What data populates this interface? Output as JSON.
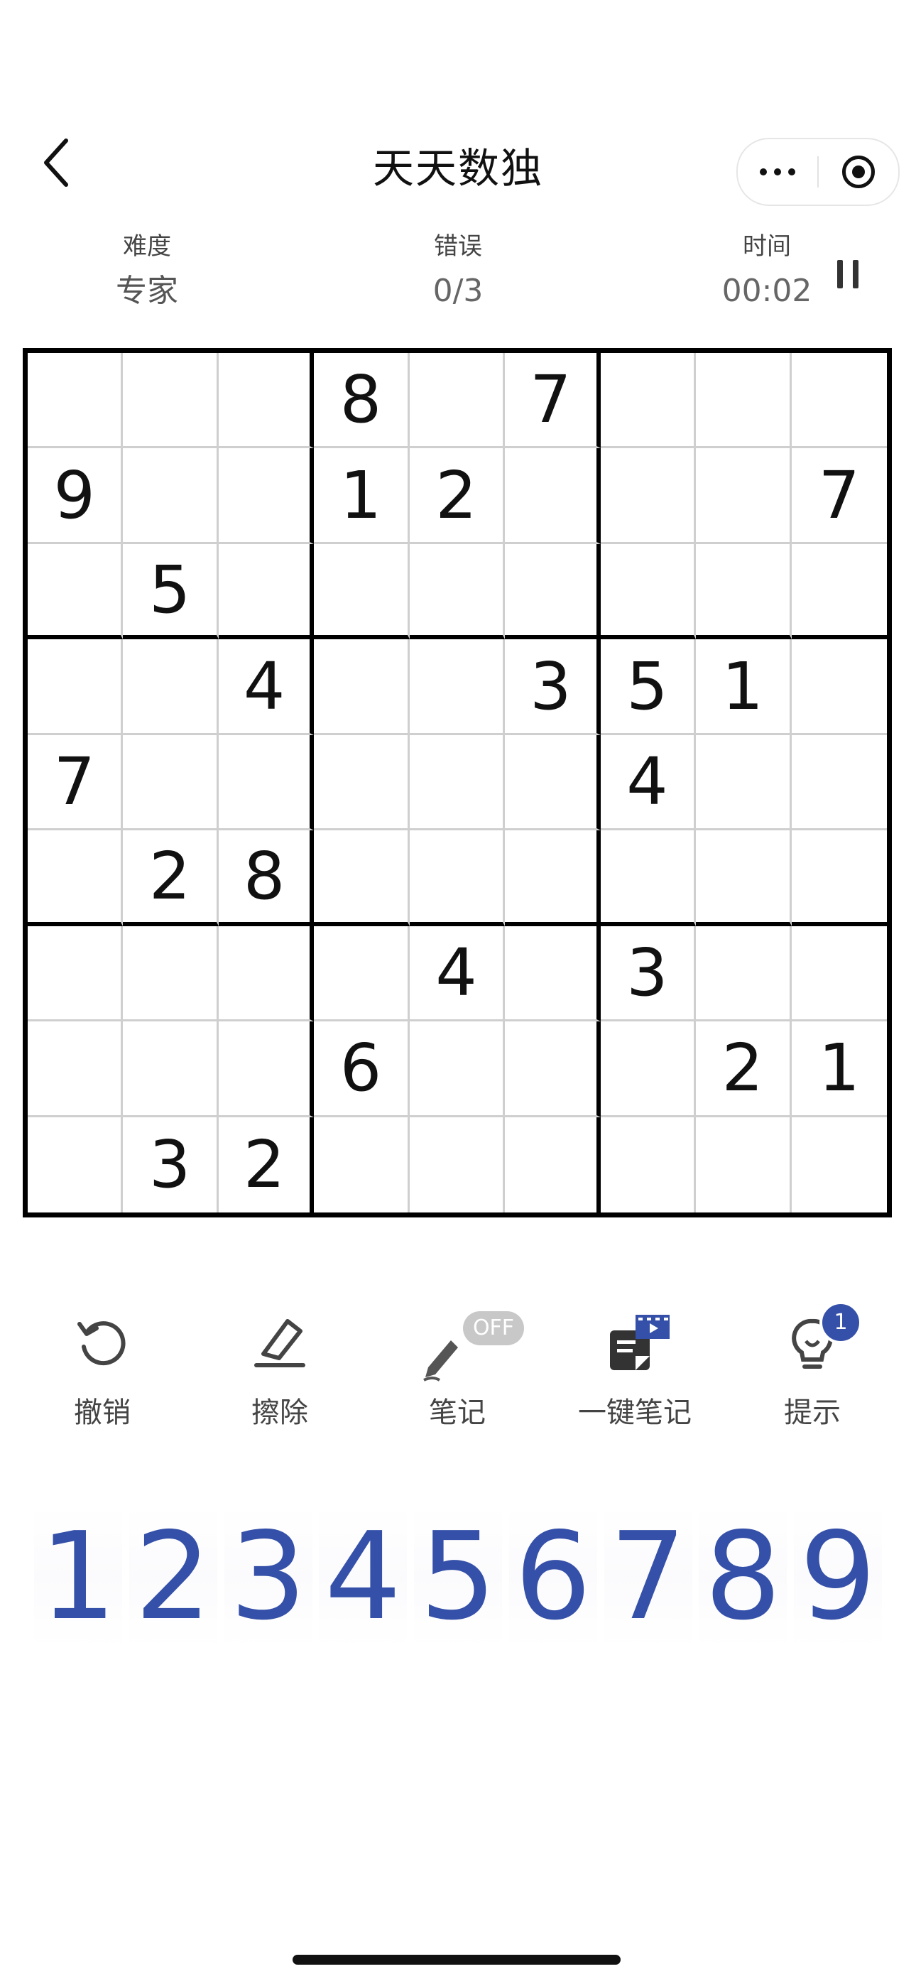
{
  "header": {
    "title": "天天数独",
    "back_icon": "chevron-left-icon",
    "menu_icon": "more-dots-icon",
    "target_icon": "target-icon"
  },
  "stats": {
    "difficulty_label": "难度",
    "difficulty_value": "专家",
    "errors_label": "错误",
    "errors_value": "0/3",
    "time_label": "时间",
    "time_value": "00:02",
    "pause_icon": "pause-icon"
  },
  "board": {
    "rows": [
      [
        "",
        "",
        "",
        "8",
        "",
        "7",
        "",
        "",
        ""
      ],
      [
        "9",
        "",
        "",
        "1",
        "2",
        "",
        "",
        "",
        "7"
      ],
      [
        "",
        "5",
        "",
        "",
        "",
        "",
        "",
        "",
        ""
      ],
      [
        "",
        "",
        "4",
        "",
        "",
        "3",
        "5",
        "1",
        ""
      ],
      [
        "7",
        "",
        "",
        "",
        "",
        "",
        "4",
        "",
        ""
      ],
      [
        "",
        "2",
        "8",
        "",
        "",
        "",
        "",
        "",
        ""
      ],
      [
        "",
        "",
        "",
        "",
        "4",
        "",
        "3",
        "",
        ""
      ],
      [
        "",
        "",
        "",
        "6",
        "",
        "",
        "",
        "2",
        "1"
      ],
      [
        "",
        "3",
        "2",
        "",
        "",
        "",
        "",
        "",
        ""
      ]
    ]
  },
  "tools": {
    "undo_label": "撤销",
    "erase_label": "擦除",
    "note_label": "笔记",
    "note_state": "OFF",
    "auto_note_label": "一键笔记",
    "hint_label": "提示",
    "hint_count": "1"
  },
  "numpad": [
    "1",
    "2",
    "3",
    "4",
    "5",
    "6",
    "7",
    "8",
    "9"
  ],
  "colors": {
    "accent": "#3550a8",
    "grid_thick": "#000000",
    "grid_thin": "#cfcfcf"
  }
}
